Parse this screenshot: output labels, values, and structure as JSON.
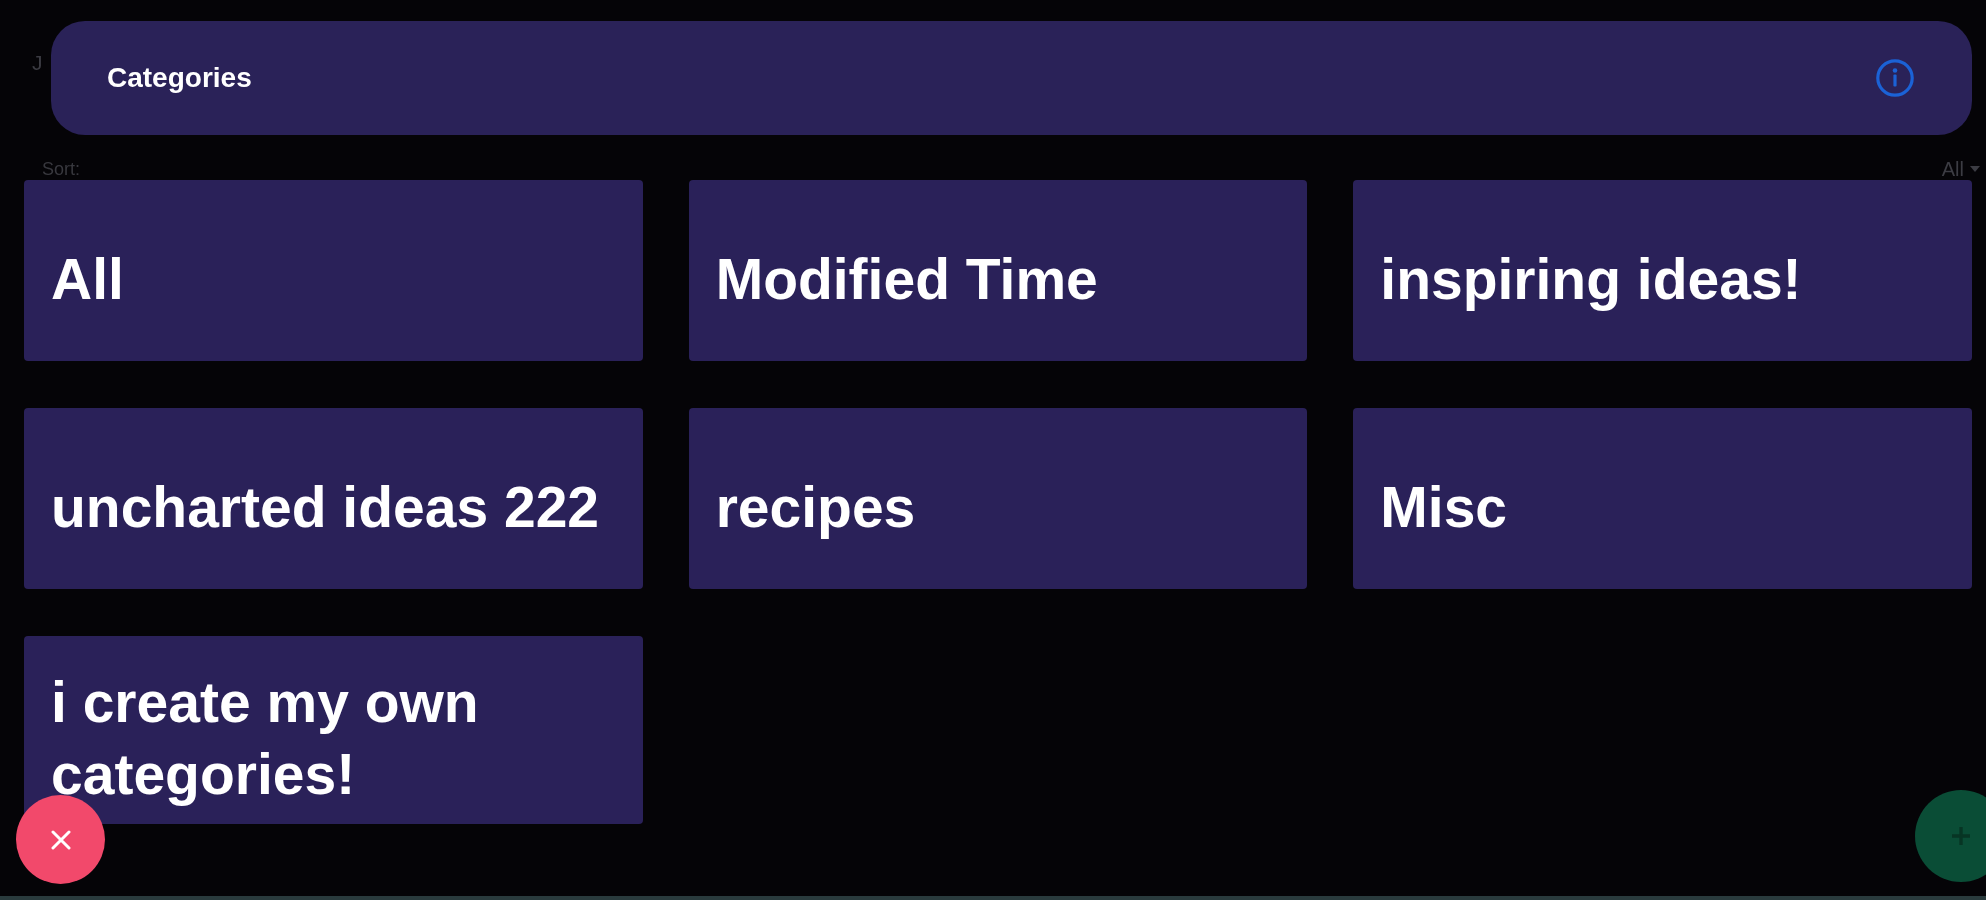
{
  "background": {
    "title": "J",
    "sort_label": "Sort:",
    "sort_value": "All"
  },
  "dialog": {
    "title": "Categories"
  },
  "categories": [
    {
      "label": "All"
    },
    {
      "label": "Modified Time"
    },
    {
      "label": "inspiring ideas!"
    },
    {
      "label": "uncharted ideas 222"
    },
    {
      "label": "recipes"
    },
    {
      "label": "Misc"
    },
    {
      "label": "i create my own categories!"
    }
  ]
}
